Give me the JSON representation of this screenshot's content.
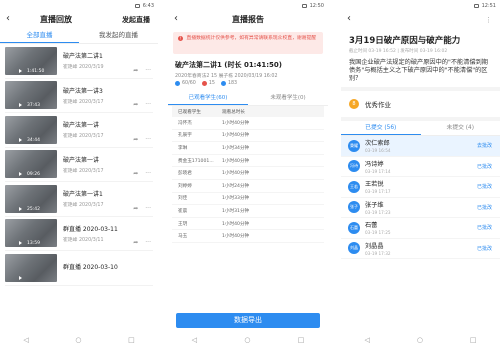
{
  "colors": {
    "accent": "#2d8cf0",
    "warning": "#e5534b",
    "medal": "#f6a623"
  },
  "screen1": {
    "status_time": "6:43",
    "back_icon": "chevron-left-icon",
    "title": "直播回放",
    "right_action": "发起直播",
    "tabs": [
      "全部直播",
      "我发起的直播"
    ],
    "videos": [
      {
        "title": "破产法第二讲1",
        "teacher": "崔艳峰",
        "date": "2020/3/19",
        "duration": "1:41:50"
      },
      {
        "title": "破产法第一讲3",
        "teacher": "崔艳峰",
        "date": "2020/3/17",
        "duration": "37:43"
      },
      {
        "title": "破产法第一讲",
        "teacher": "崔艳峰",
        "date": "2020/3/17",
        "duration": "34:44"
      },
      {
        "title": "破产法第一讲",
        "teacher": "崔艳峰",
        "date": "2020/3/17",
        "duration": "09:26"
      },
      {
        "title": "破产法第一讲1",
        "teacher": "崔艳峰",
        "date": "2020/3/17",
        "duration": "25:42"
      },
      {
        "title": "群直播 2020-03-11",
        "teacher": "崔艳峰",
        "date": "2020/3/11",
        "duration": "13:59"
      },
      {
        "title": "群直播 2020-03-10",
        "teacher": "",
        "date": "",
        "duration": ""
      }
    ]
  },
  "screen2": {
    "status_time": "12:50",
    "title": "直播报告",
    "warning": "直播数据统计仅供参考，如有异常请联系现众校直，谢谢提醒",
    "report_title": "破产法第二讲1 (时长 01:41:50)",
    "report_meta": "2020年春商法2 15 展子栋 2020/03/19 16:02",
    "stat_viewers": "60/60",
    "stat_likes": "15",
    "stat_comments": "183",
    "tabs": [
      "已观看学生(60)",
      "未观看学生(0)"
    ],
    "table_headers": [
      "已观看学生",
      "观看总时长"
    ],
    "rows": [
      {
        "name": "冯怀杰",
        "time": "1小时40分钟"
      },
      {
        "name": "孔辰宇",
        "time": "1小时40分钟"
      },
      {
        "name": "李琳",
        "time": "1小时34分钟"
      },
      {
        "name": "费金玉171001...",
        "time": "1小时40分钟"
      },
      {
        "name": "彭晓君",
        "time": "1小时40分钟"
      },
      {
        "name": "刘婷婷",
        "time": "1小时24分钟"
      },
      {
        "name": "刘佳",
        "time": "1小时33分钟"
      },
      {
        "name": "崔晨",
        "time": "1小时31分钟"
      },
      {
        "name": "王玥",
        "time": "1小时40分钟"
      },
      {
        "name": "马玉",
        "time": "1小时40分钟"
      }
    ],
    "export_label": "数据导出"
  },
  "screen3": {
    "status_time": "12:51",
    "title": "3月19日破产原因与破产能力",
    "meta": "截止时间 03-19 16:52 | 发布时间 03-19 16:02",
    "question": "我国企业破产法规定的破产原因中的\"不能清偿到期债务\"与概括主义之下破产原因中的\"不能清偿\"的区别？",
    "excellent_label": "优秀作业",
    "tabs": [
      "已提交 (56)",
      "未提交 (4)"
    ],
    "students": [
      {
        "avatar": "秉耀",
        "name": "次仁索郎",
        "time": "03-19 16:54",
        "status": "去批改"
      },
      {
        "avatar": "冯诗",
        "name": "冯诗婷",
        "time": "03-19 17:14",
        "status": "已批改"
      },
      {
        "avatar": "王若",
        "name": "王若锐",
        "time": "03-19 17:17",
        "status": "已批改"
      },
      {
        "avatar": "张子",
        "name": "张子维",
        "time": "03-19 17:23",
        "status": "已批改"
      },
      {
        "avatar": "石蕾",
        "name": "石蕾",
        "time": "03-19 17:25",
        "status": "已批改"
      },
      {
        "avatar": "刘晶",
        "name": "刘晶晶",
        "time": "03-19 17:32",
        "status": "已批改"
      }
    ]
  }
}
